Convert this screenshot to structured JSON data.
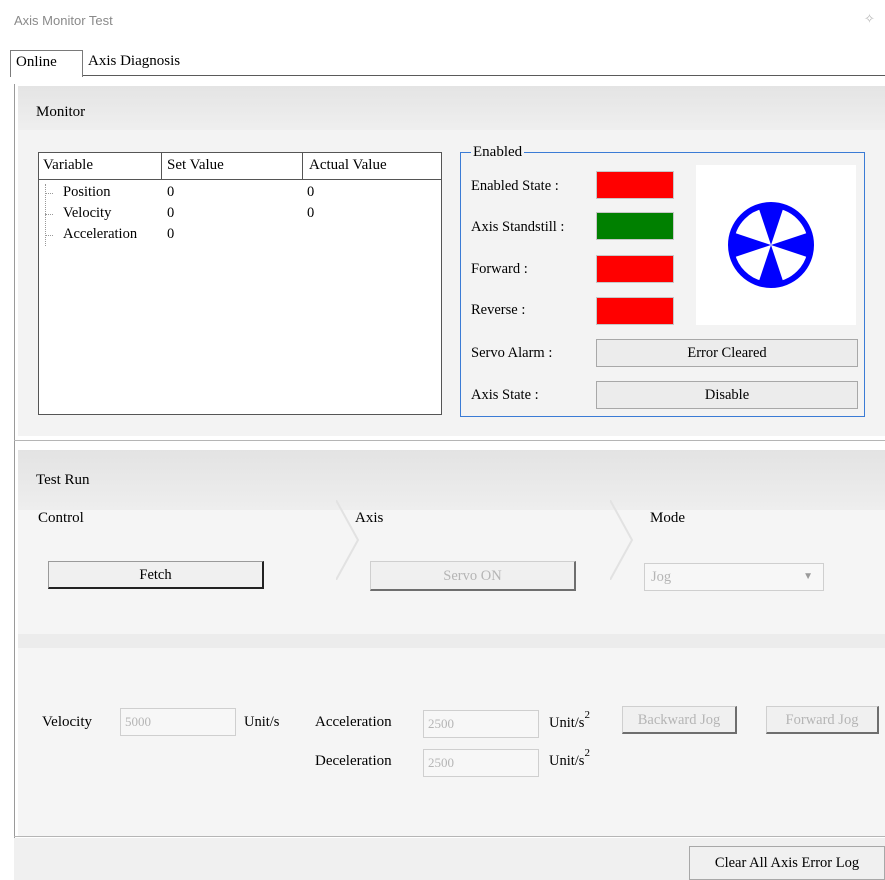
{
  "window": {
    "title": "Axis Monitor Test",
    "pin_icon": "pin-icon"
  },
  "tabs": [
    {
      "label": "Online",
      "active": true
    },
    {
      "label": "Axis Diagnosis",
      "active": false
    }
  ],
  "monitor": {
    "title": "Monitor",
    "table": {
      "columns": [
        "Variable",
        "Set Value",
        "Actual Value"
      ],
      "rows": [
        {
          "variable": "Position",
          "set": "0",
          "actual": "0"
        },
        {
          "variable": "Velocity",
          "set": "0",
          "actual": "0"
        },
        {
          "variable": "Acceleration",
          "set": "0",
          "actual": ""
        }
      ]
    },
    "enabled": {
      "group_label": "Enabled",
      "enabled_state_label": "Enabled State :",
      "standstill_label": "Axis Standstill :",
      "forward_label": "Forward :",
      "reverse_label": "Reverse :",
      "servo_alarm_label": "Servo Alarm :",
      "servo_alarm_value": "Error Cleared",
      "axis_state_label": "Axis State :",
      "axis_state_value": "Disable",
      "colors": {
        "red": "#ff0000",
        "green": "#008000",
        "wheel_blue": "#0000ff"
      },
      "indicators": {
        "enabled_state": "red",
        "axis_standstill": "green",
        "forward": "red",
        "reverse": "red"
      }
    }
  },
  "test_run": {
    "title": "Test Run",
    "control_label": "Control",
    "axis_label": "Axis",
    "mode_label": "Mode",
    "fetch_button": "Fetch",
    "servo_on_button": "Servo ON",
    "mode_value": "Jog",
    "velocity_label": "Velocity",
    "velocity_value": "5000",
    "velocity_unit": "Unit/s",
    "acceleration_label": "Acceleration",
    "acceleration_value": "2500",
    "deceleration_label": "Deceleration",
    "deceleration_value": "2500",
    "accel_unit": "Unit/s",
    "decel_unit": "Unit/s",
    "unit_exponent": "2",
    "backward_jog_button": "Backward Jog",
    "forward_jog_button": "Forward Jog"
  },
  "footer": {
    "clear_log_button": "Clear All Axis Error Log"
  }
}
